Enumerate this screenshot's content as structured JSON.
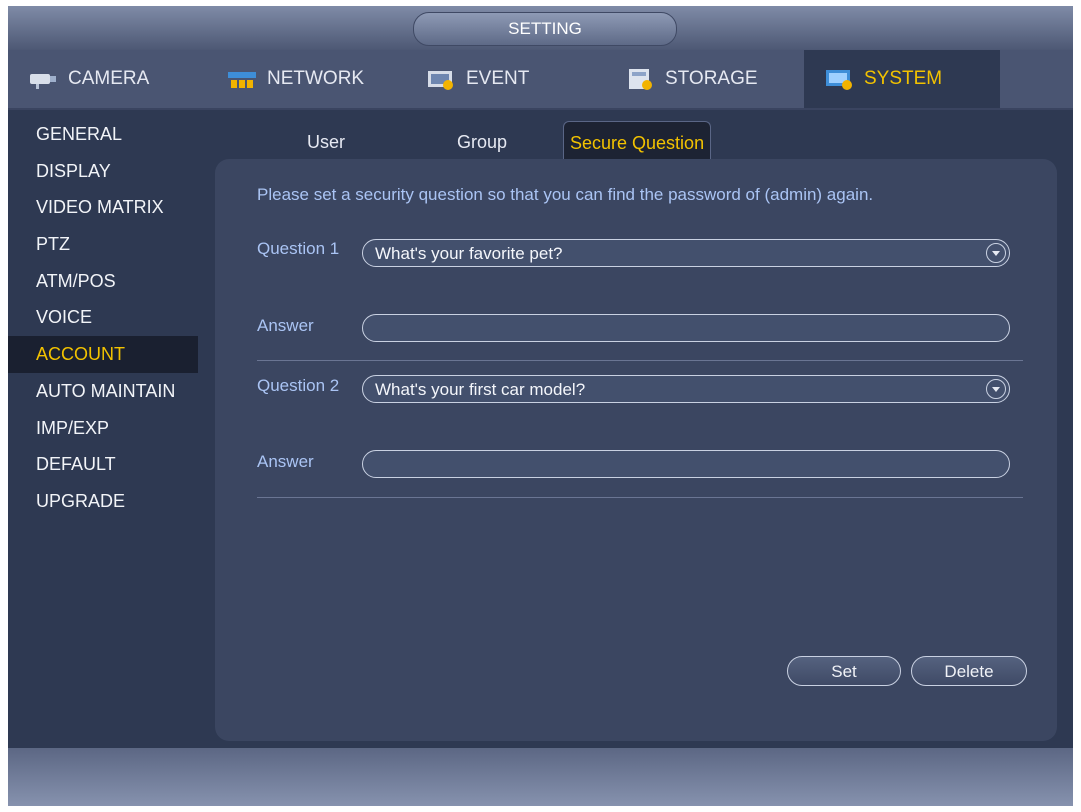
{
  "window": {
    "title": "SETTING"
  },
  "main_tabs": [
    {
      "label": "CAMERA",
      "icon": "camera-icon"
    },
    {
      "label": "NETWORK",
      "icon": "network-icon"
    },
    {
      "label": "EVENT",
      "icon": "event-icon"
    },
    {
      "label": "STORAGE",
      "icon": "storage-icon"
    },
    {
      "label": "SYSTEM",
      "icon": "system-icon",
      "active": true
    }
  ],
  "sidebar": {
    "items": [
      {
        "label": "GENERAL"
      },
      {
        "label": "DISPLAY"
      },
      {
        "label": "VIDEO MATRIX"
      },
      {
        "label": "PTZ"
      },
      {
        "label": "ATM/POS"
      },
      {
        "label": "VOICE"
      },
      {
        "label": "ACCOUNT",
        "active": true
      },
      {
        "label": "AUTO MAINTAIN"
      },
      {
        "label": "IMP/EXP"
      },
      {
        "label": "DEFAULT"
      },
      {
        "label": "UPGRADE"
      }
    ]
  },
  "sub_tabs": [
    {
      "label": "User"
    },
    {
      "label": "Group"
    },
    {
      "label": "Secure Question",
      "active": true
    }
  ],
  "form": {
    "notice": "Please set a security question so that you can find the password of (admin) again.",
    "question1_label": "Question 1",
    "question1_value": "What's your favorite pet?",
    "answer1_label": "Answer",
    "answer1_value": "",
    "question2_label": "Question 2",
    "question2_value": "What's your first car model?",
    "answer2_label": "Answer",
    "answer2_value": ""
  },
  "buttons": {
    "set": "Set",
    "delete": "Delete"
  },
  "colors": {
    "accent": "#f2c200",
    "label": "#aac4f4",
    "background": "#2e3952"
  }
}
